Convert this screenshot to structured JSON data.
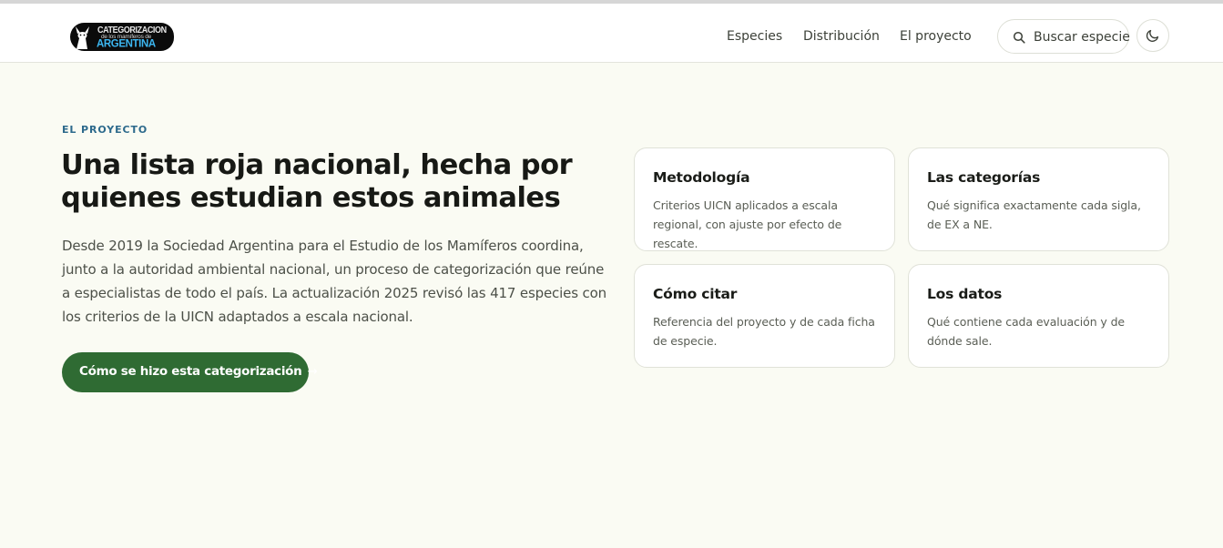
{
  "header": {
    "logo": {
      "line1": "CATEGORIZACION",
      "line2": "de los mamíferos de",
      "line3": "ARGENTINA"
    },
    "nav": [
      "Especies",
      "Distribución",
      "El proyecto"
    ],
    "search_label": "Buscar especie",
    "theme_icon": "moon-icon"
  },
  "hero": {
    "eyebrow": "EL PROYECTO",
    "title": "Una lista roja nacional, hecha por quienes estudian estos animales",
    "lead": "Desde 2019 la Sociedad Argentina para el Estudio de los Mamíferos coordina, junto a la autoridad ambiental nacional, un proceso de categorización que reúne a especialistas de todo el país. La actualización 2025 revisó las 417 especies con los criterios de la UICN adaptados a escala nacional.",
    "cta_label": "Cómo se hizo esta categorización",
    "cta_arrow": "→"
  },
  "cards": [
    {
      "title": "Metodología",
      "desc": "Criterios UICN aplicados a escala regional, con ajuste por efecto de rescate."
    },
    {
      "title": "Las categorías",
      "desc": "Qué significa exactamente cada sigla, de EX a NE."
    },
    {
      "title": "Cómo citar",
      "desc": "Referencia del proyecto y de cada ficha de especie."
    },
    {
      "title": "Los datos",
      "desc": "Qué contiene cada evaluación y de dónde sale."
    }
  ],
  "colors": {
    "accent": "#2f6b33",
    "eyebrow": "#2d6a8c",
    "background": "#fafbf3"
  }
}
